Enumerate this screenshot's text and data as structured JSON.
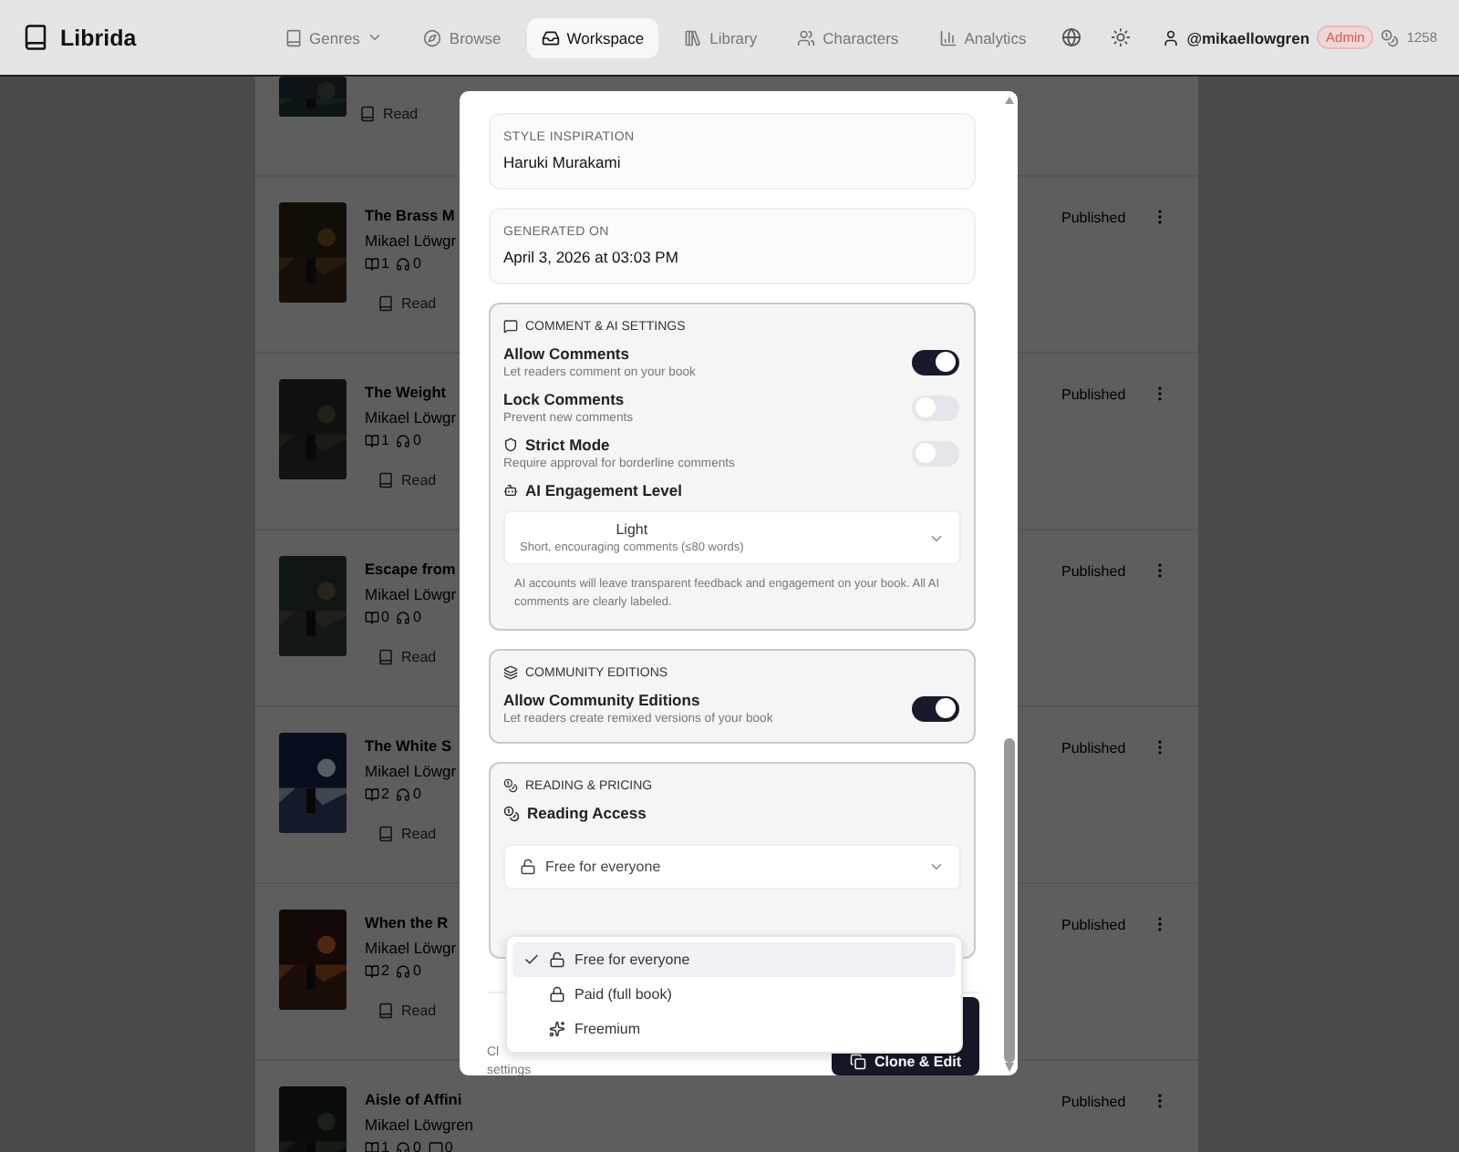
{
  "nav": {
    "logo": "Librida",
    "items": [
      {
        "label": "Genres",
        "kind": "dropdown",
        "selected": false
      },
      {
        "label": "Browse",
        "kind": "link",
        "selected": false
      },
      {
        "label": "Workspace",
        "kind": "link",
        "selected": true
      },
      {
        "label": "Library",
        "kind": "link",
        "selected": false
      },
      {
        "label": "Characters",
        "kind": "link",
        "selected": false
      },
      {
        "label": "Analytics",
        "kind": "link",
        "selected": false
      }
    ],
    "user": "@mikaellowgren",
    "role": "Admin",
    "credits": "1258"
  },
  "books": [
    {
      "read": "Read"
    },
    {
      "title": "The Brass M",
      "author": "Mikael Löwgr",
      "stats": [
        "1",
        "0"
      ],
      "read": "Read",
      "status": "Published"
    },
    {
      "title": "The Weight",
      "author": "Mikael Löwgr",
      "stats": [
        "1",
        "0"
      ],
      "read": "Read",
      "status": "Published"
    },
    {
      "title": "Escape from",
      "author": "Mikael Löwgr",
      "stats": [
        "0",
        "0"
      ],
      "read": "Read",
      "status": "Published"
    },
    {
      "title": "The White S",
      "author": "Mikael Löwgr",
      "stats": [
        "2",
        "0"
      ],
      "read": "Read",
      "status": "Published"
    },
    {
      "title": "When the R",
      "author": "Mikael Löwgr",
      "stats": [
        "2",
        "0"
      ],
      "read": "Read",
      "status": "Published"
    },
    {
      "title": "Aisle of Affini",
      "author": "Mikael Löwgren",
      "stats": [
        "1",
        "0",
        "0"
      ],
      "status": "Published"
    }
  ],
  "modal": {
    "info": [
      {
        "label": "STYLE INSPIRATION",
        "value": "Haruki Murakami"
      },
      {
        "label": "GENERATED ON",
        "value": "April 3, 2026 at 03:03 PM"
      }
    ],
    "comment_settings": {
      "heading": "COMMENT & AI SETTINGS",
      "toggles": [
        {
          "label": "Allow Comments",
          "description": "Let readers comment on your book",
          "on": true
        },
        {
          "label": "Lock Comments",
          "description": "Prevent new comments",
          "on": false
        },
        {
          "label": "Strict Mode",
          "description": "Require approval for borderline comments",
          "on": false
        }
      ],
      "engagement": {
        "label": "AI Engagement Level",
        "value": "Light",
        "description": "Short, encouraging comments (≤80 words)"
      },
      "note": "AI accounts will leave transparent feedback and engagement on your book. All AI comments are clearly labeled."
    },
    "community": {
      "heading": "COMMUNITY EDITIONS",
      "toggle": {
        "label": "Allow Community Editions",
        "description": "Let readers create remixed versions of your book",
        "on": true
      }
    },
    "pricing": {
      "heading": "READING & PRICING",
      "label": "Reading Access",
      "value": "Free for everyone",
      "options": [
        {
          "label": "Free for everyone",
          "selected": true
        },
        {
          "label": "Paid (full book)",
          "selected": false
        },
        {
          "label": "Freemium",
          "selected": false
        }
      ]
    },
    "footer_note": [
      "Cl",
      "settings"
    ],
    "action": "Clone & Edit"
  }
}
